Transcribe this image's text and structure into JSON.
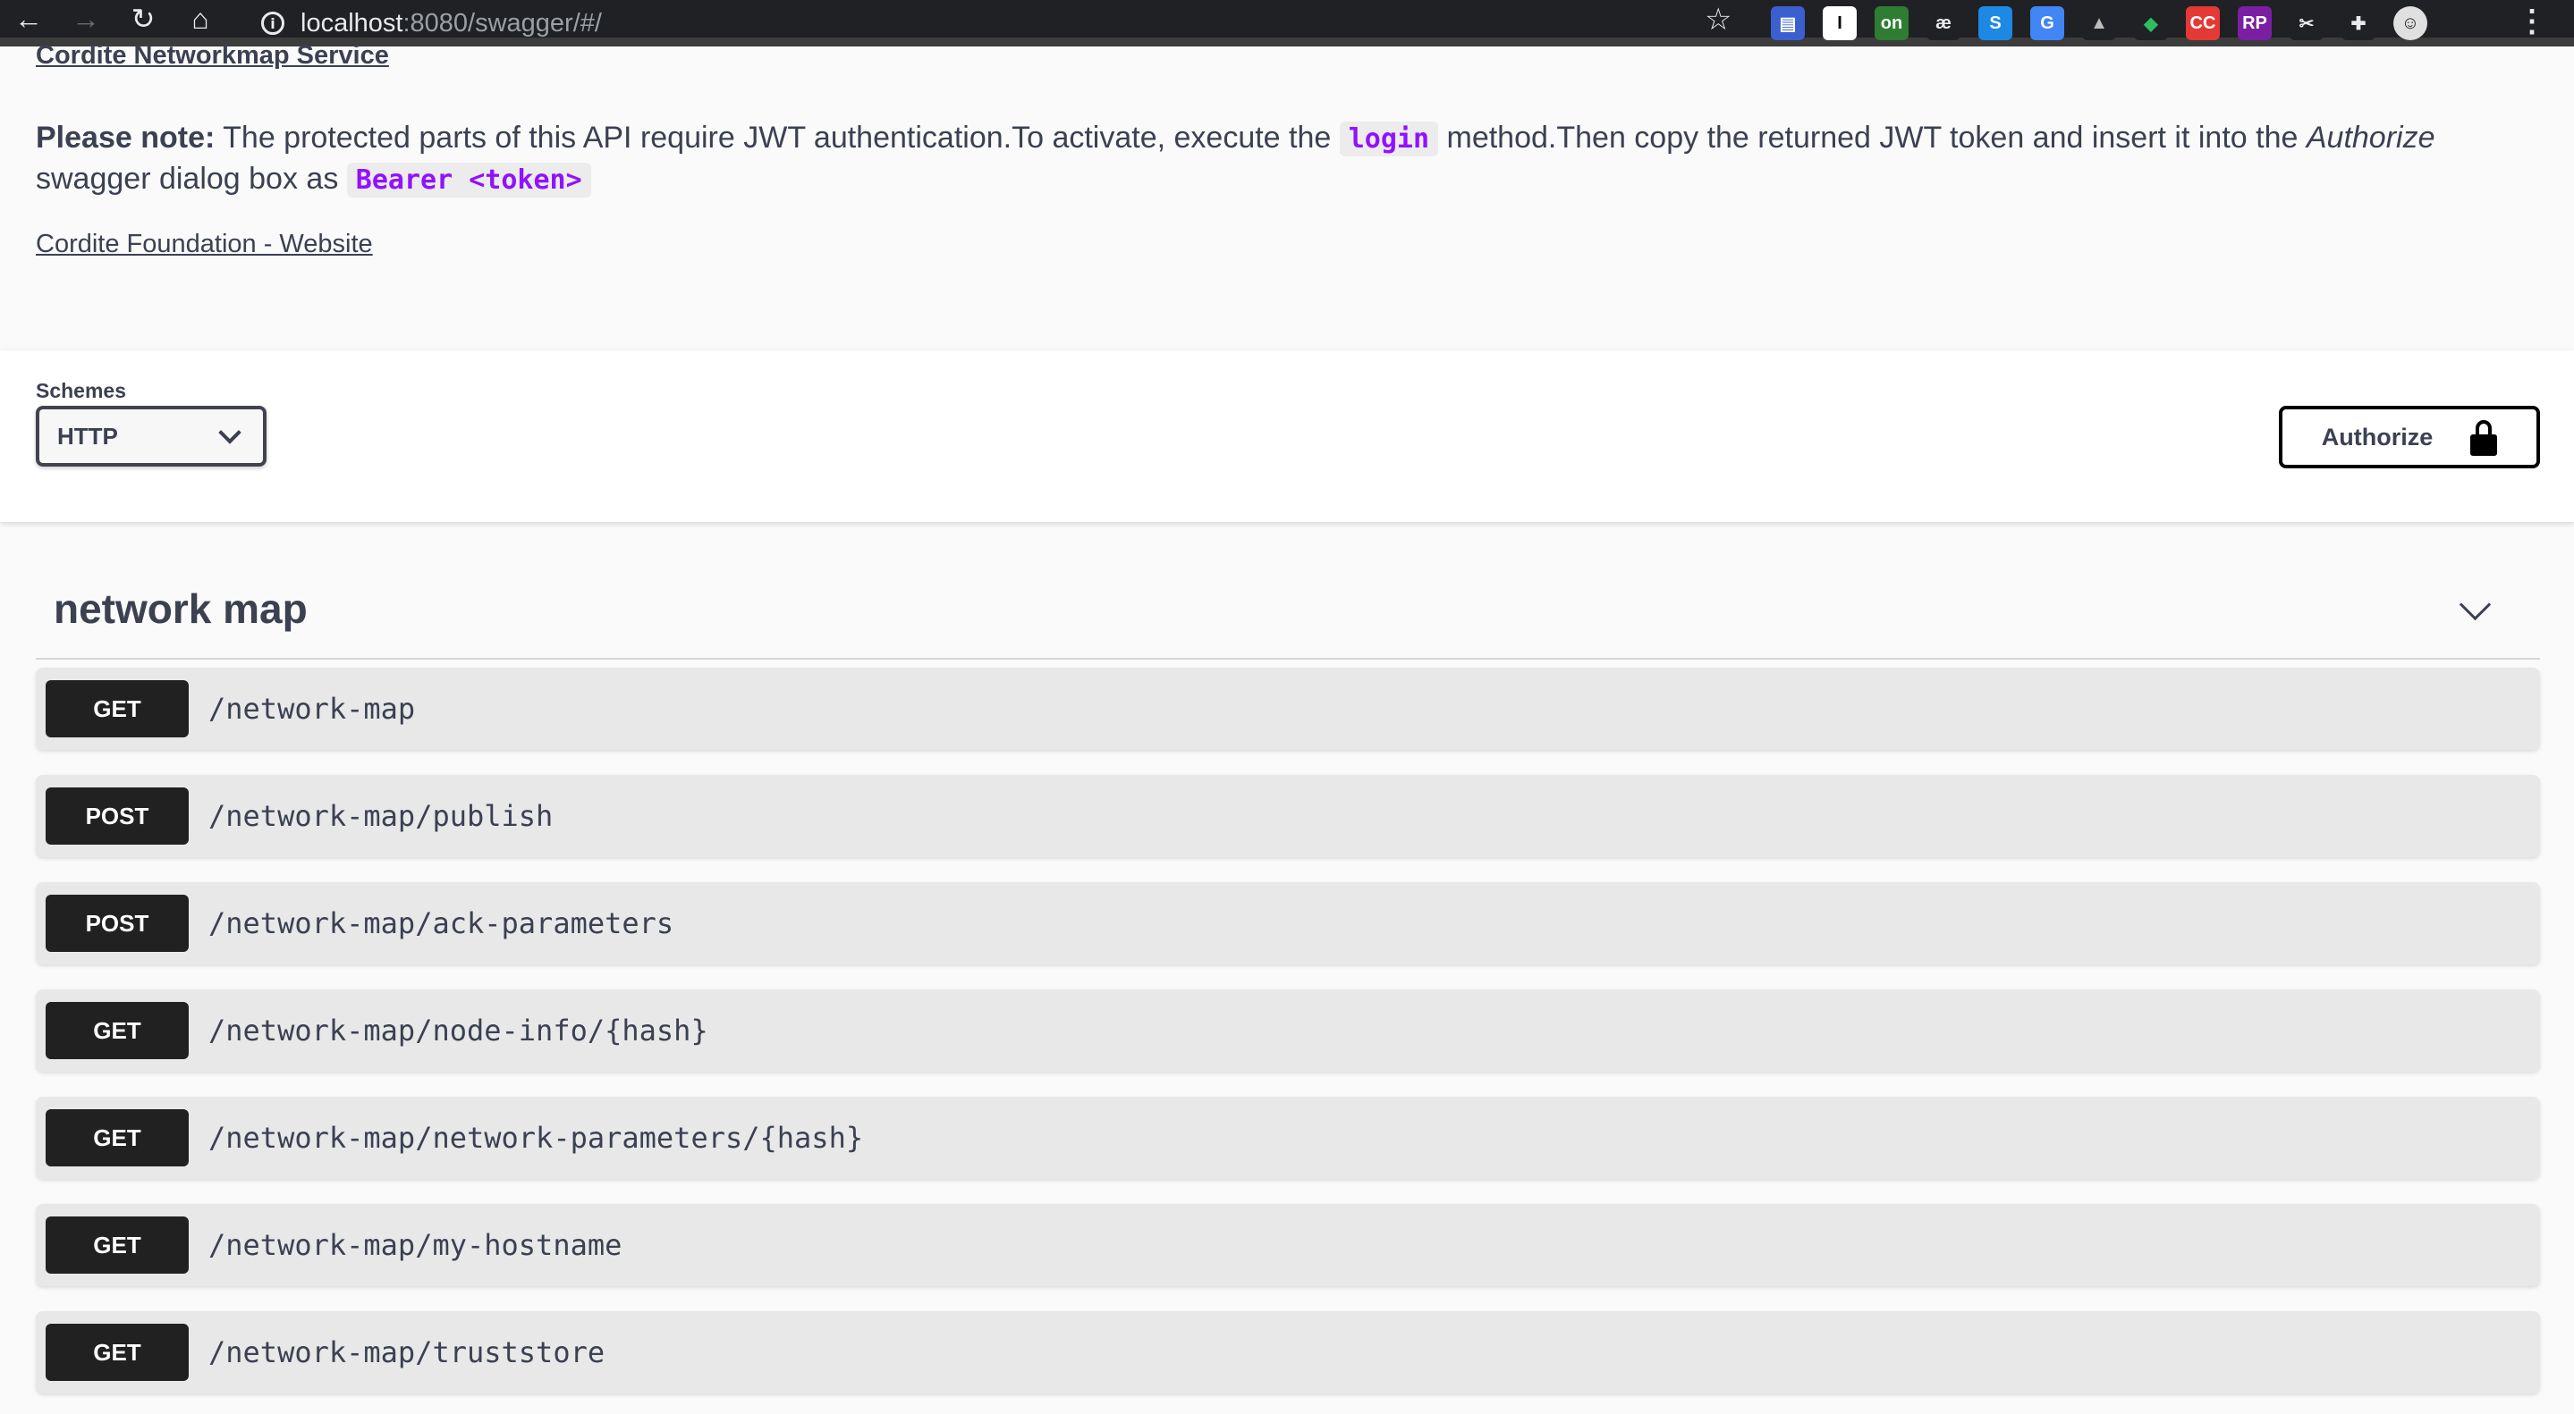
{
  "browser": {
    "back": "←",
    "forward": "→",
    "reload": "↻",
    "home": "⌂",
    "url_host": "localhost",
    "url_rest": ":8080/swagger/#/",
    "star": "☆",
    "menu": "⋮",
    "extensions": [
      {
        "name": "ext-doc-icon",
        "glyph": "▤",
        "color": "#ffffff",
        "bg": "#3b5fcf"
      },
      {
        "name": "ext-instapaper-icon",
        "glyph": "I",
        "color": "#000000",
        "bg": "#ffffff"
      },
      {
        "name": "ext-on-icon",
        "glyph": "on",
        "color": "#ffffff",
        "bg": "#2e7d32"
      },
      {
        "name": "ext-ae-icon",
        "glyph": "æ",
        "color": "#e8eaed",
        "bg": "#202124"
      },
      {
        "name": "ext-s-icon",
        "glyph": "S",
        "color": "#ffffff",
        "bg": "#1e88e5"
      },
      {
        "name": "ext-translate-icon",
        "glyph": "G",
        "color": "#ffffff",
        "bg": "#4285f4"
      },
      {
        "name": "ext-drive-icon",
        "glyph": "▲",
        "color": "#bdbdbd",
        "bg": "#202124"
      },
      {
        "name": "ext-evernote-icon",
        "glyph": "◆",
        "color": "#2dbe60",
        "bg": "#202124"
      },
      {
        "name": "ext-cc-icon",
        "glyph": "CC",
        "color": "#ffffff",
        "bg": "#e53935"
      },
      {
        "name": "ext-rp-icon",
        "glyph": "RP",
        "color": "#ffffff",
        "bg": "#7b1fa2"
      },
      {
        "name": "ext-scissors-icon",
        "glyph": "✂",
        "color": "#e8eaed",
        "bg": "#202124"
      },
      {
        "name": "ext-puzzle-icon",
        "glyph": "✚",
        "color": "#e8eaed",
        "bg": "#202124"
      },
      {
        "name": "profile-avatar-icon",
        "glyph": "☺",
        "color": "#202124",
        "bg": "#e0e0e0"
      }
    ]
  },
  "info": {
    "title": "Cordite Networkmap Service",
    "note_label": "Please note:",
    "note_text_1": " The protected parts of this API require JWT authentication.To activate, execute the ",
    "note_code_1": "login",
    "note_text_2": " method.Then copy the returned JWT token and insert it into the ",
    "note_italic": "Authorize",
    "note_text_3": " swagger dialog box as ",
    "note_code_2": "Bearer <token>",
    "website_link": "Cordite Foundation - Website"
  },
  "schemes": {
    "label": "Schemes",
    "selected": "HTTP"
  },
  "authorize": {
    "label": "Authorize"
  },
  "tag": {
    "title": "network map"
  },
  "operations": [
    {
      "method": "GET",
      "path": "/network-map"
    },
    {
      "method": "POST",
      "path": "/network-map/publish"
    },
    {
      "method": "POST",
      "path": "/network-map/ack-parameters"
    },
    {
      "method": "GET",
      "path": "/network-map/node-info/{hash}"
    },
    {
      "method": "GET",
      "path": "/network-map/network-parameters/{hash}"
    },
    {
      "method": "GET",
      "path": "/network-map/my-hostname"
    },
    {
      "method": "GET",
      "path": "/network-map/truststore"
    }
  ]
}
